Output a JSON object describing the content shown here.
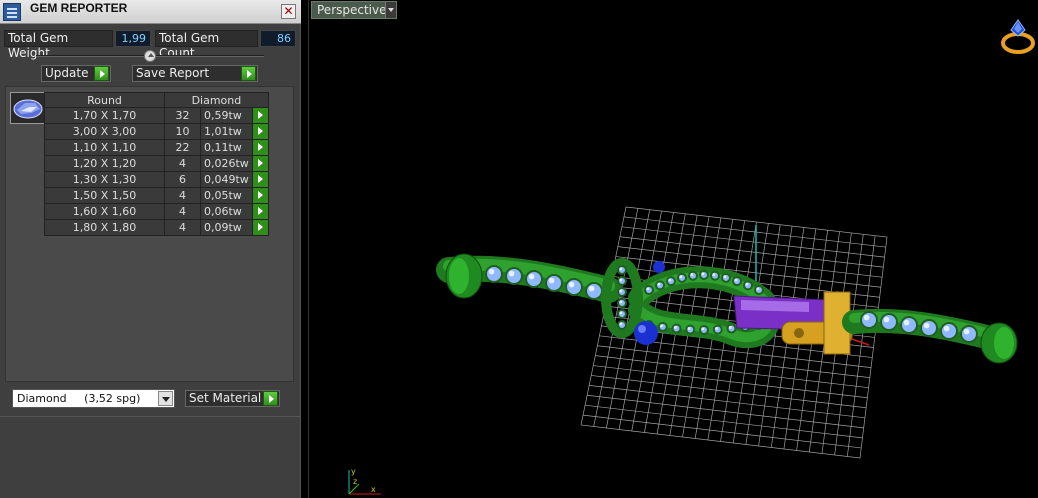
{
  "panel": {
    "title": "GEM REPORTER",
    "close_symbol": "✕",
    "total_weight_label": "Total Gem Weight",
    "total_weight_value": "1,99",
    "total_count_label": "Total Gem Count",
    "total_count_value": "86",
    "update_label": "Update",
    "save_label": "Save Report",
    "table": {
      "headers": [
        "Round",
        "Diamond"
      ],
      "rows": [
        {
          "size": "1,70 X 1,70",
          "count": "32",
          "weight": "0,59tw"
        },
        {
          "size": "3,00 X 3,00",
          "count": "10",
          "weight": "1,01tw"
        },
        {
          "size": "1,10 X 1,10",
          "count": "22",
          "weight": "0,11tw"
        },
        {
          "size": "1,20 X 1,20",
          "count": "4",
          "weight": "0,026tw"
        },
        {
          "size": "1,30 X 1,30",
          "count": "6",
          "weight": "0,049tw"
        },
        {
          "size": "1,50 X 1,50",
          "count": "4",
          "weight": "0,05tw"
        },
        {
          "size": "1,60 X 1,60",
          "count": "4",
          "weight": "0,06tw"
        },
        {
          "size": "1,80 X 1,80",
          "count": "4",
          "weight": "0,09tw"
        }
      ]
    },
    "material_select_value": "Diamond     (3,52 spg)",
    "set_material_label": "Set Material"
  },
  "viewport": {
    "view_mode": "Perspective",
    "icons": [
      "ring-icon",
      "axis-gizmo-icon"
    ]
  },
  "colors": {
    "panel_bg": "#3f3f3f",
    "accent_green": "#2f8f1a",
    "value_blue": "#7fd0ff"
  }
}
